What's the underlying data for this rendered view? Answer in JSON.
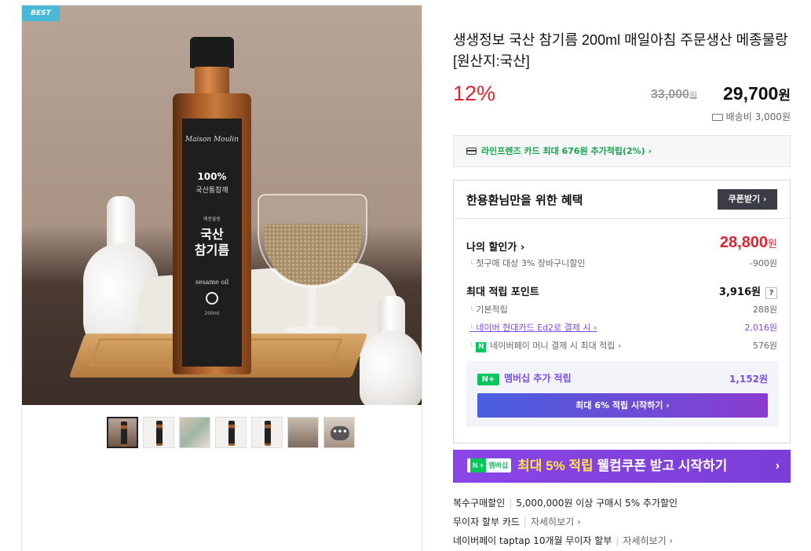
{
  "gallery": {
    "badge": "BEST",
    "label_brand": "Maison Moulin",
    "label_pct": "100%",
    "label_small": "국산통참깨",
    "label_tiny": "메종물랑",
    "label_big_1": "국산",
    "label_big_2": "참기름",
    "label_oil": "sesame oil",
    "label_vol": "200ml",
    "thumbnails": [
      "main",
      "bottle",
      "photo",
      "bottle",
      "bottle",
      "photo",
      "more"
    ],
    "more_icon": "•••"
  },
  "product": {
    "title": "생생정보 국산 참기름 200ml 매일아침 주문생산 메종물랑 [원산지:국산]",
    "discount_rate": "12%",
    "original_price": "33,000",
    "original_unit": "원",
    "price": "29,700",
    "price_unit": "원",
    "shipping": "배송비 3,000원"
  },
  "card_offer": {
    "text": "라인프렌즈 카드 최대 676원 추가적립(2%) ›"
  },
  "benefits": {
    "title": "한용환님만을 위한 혜택",
    "coupon_button": "쿠폰받기 ›",
    "my_price_label": "나의 할인가 ›",
    "my_price": "28,800",
    "my_price_unit": "원",
    "first_buy_label": "첫구매 대상 3% 장바구니할인",
    "first_buy_value": "-900원",
    "points_label": "최대 적립 포인트",
    "points_value": "3,916원",
    "points_help": "?",
    "basic_label": "기본적립",
    "basic_value": "288원",
    "card_label": "네이버 현대카드 Ed2로 결제 시 ›",
    "card_value": "2,016원",
    "npay_label": "네이버페이 머니 결제 시 최대 적립 ›",
    "npay_value": "576원",
    "member_label": "멤버십 추가 적립",
    "member_value": "1,152원",
    "member_button": "최대 6% 적립 시작하기 ›"
  },
  "promo": {
    "badge_n": "N +",
    "badge_text": "멤버십",
    "highlight": "최대 5% 적립",
    "rest": " 웰컴쿠폰 받고 시작하기",
    "arrow": "›"
  },
  "extra_info": [
    {
      "label": "복수구매할인",
      "value": "5,000,000원 이상 구매시 5% 추가할인",
      "link": ""
    },
    {
      "label": "무이자 할부 카드",
      "value": "",
      "link": "자세히보기 ›"
    },
    {
      "label": "네이버페이 taptap 10개월 무이자 할부",
      "value": "",
      "link": "자세히보기 ›"
    }
  ],
  "colors": {
    "discount_red": "#e0232e",
    "naver_green": "#03c75a",
    "membership_purple": "#7a4ee6"
  }
}
